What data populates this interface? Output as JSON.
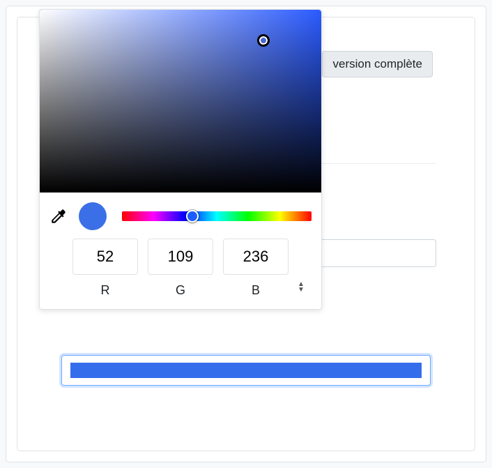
{
  "button_version_complete": "version complète",
  "picker": {
    "rgb": {
      "r": "52",
      "g": "109",
      "b": "236"
    },
    "labels": {
      "r": "R",
      "g": "G",
      "b": "B"
    },
    "selected_hex": "#346dec"
  }
}
